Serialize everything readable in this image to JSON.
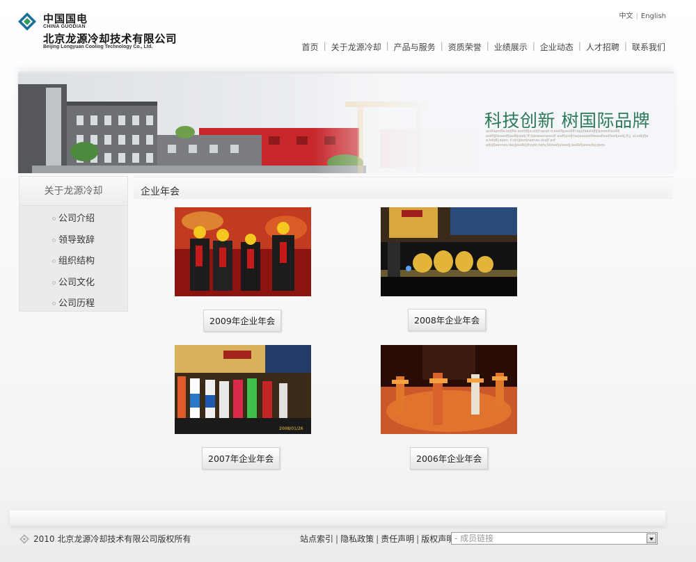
{
  "header": {
    "logo_cn": "中国国电",
    "logo_en": "CHINA GUODIAN",
    "company_cn": "北京龙源冷却技术有限公司",
    "company_en": "Beijing Longyuan Cooling Technology Co., Ltd.",
    "lang": {
      "zh": "中文",
      "en": "English"
    },
    "nav": [
      "首页",
      "关于龙源冷却",
      "产品与服务",
      "资质荣誉",
      "业绩展示",
      "企业动态",
      "人才招聘",
      "联系我们"
    ]
  },
  "banner": {
    "slogan": "科技创新 树国际品牌",
    "small_text": "asdfapsdfa;lsdjfla asdfdfja;sldjf;apsd d;asdlfjpasdlfh;lqsjfaasldjfjjfpasodfasdlfj asdiljjfasasdfjasdfpasdj ff;lsjsiwasnpasdf asdfjasdjnasjaaspsdfwasdfasdfasdjasdj,lf;j, al;sdkjfja a;lskdfj;aasn; il;sjnjjasnjnasnas,dsajf asf adsjfjasnnas;dasjjasdkjdhsjdn;lsjfa;likdasfjasosdj;asdlkfjasosdsj;qsos"
  },
  "sidebar": {
    "title": "关于龙源冷却",
    "items": [
      "公司介绍",
      "领导致辞",
      "组织结构",
      "公司文化",
      "公司历程"
    ]
  },
  "content": {
    "title": "企业年会",
    "gallery": [
      {
        "caption": "2009年企业年会"
      },
      {
        "caption": "2008年企业年会"
      },
      {
        "caption": "2007年企业年会"
      },
      {
        "caption": "2006年企业年会"
      }
    ]
  },
  "footer": {
    "copyright": "2010 北京龙源冷却技术有限公司版权所有",
    "links": [
      "站点索引",
      "隐私政策",
      "责任声明",
      "版权声明"
    ],
    "select_placeholder": "- 成员链接"
  }
}
